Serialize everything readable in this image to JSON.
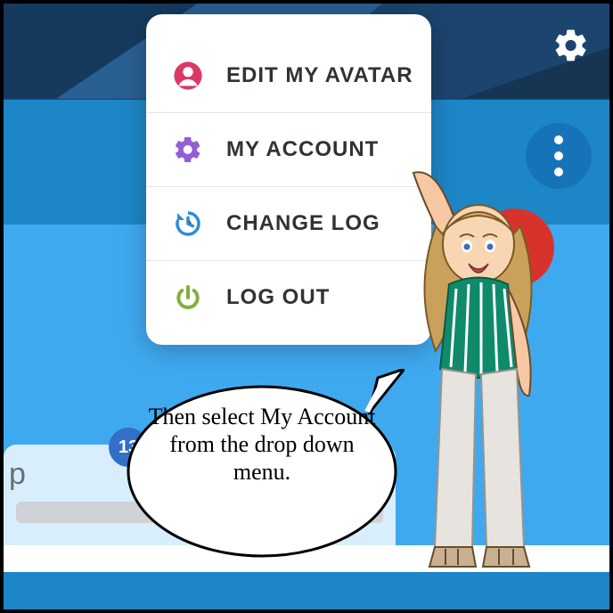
{
  "header": {
    "settings_icon": "settings"
  },
  "controls": {
    "more_button": "more-options",
    "badge_value": "13",
    "panel_hint": "p"
  },
  "menu": {
    "items": [
      {
        "icon": "avatar-icon",
        "label": "EDIT MY AVATAR"
      },
      {
        "icon": "gear-icon",
        "label": "MY ACCOUNT"
      },
      {
        "icon": "history-icon",
        "label": "CHANGE LOG"
      },
      {
        "icon": "power-icon",
        "label": "LOG OUT"
      }
    ]
  },
  "bubble": {
    "text": "Then select My Account from the drop down menu."
  },
  "colors": {
    "avatar_icon": "#d83a63",
    "gear_icon": "#9160d6",
    "history_icon": "#2e8bd8",
    "power_icon": "#7fb239"
  }
}
